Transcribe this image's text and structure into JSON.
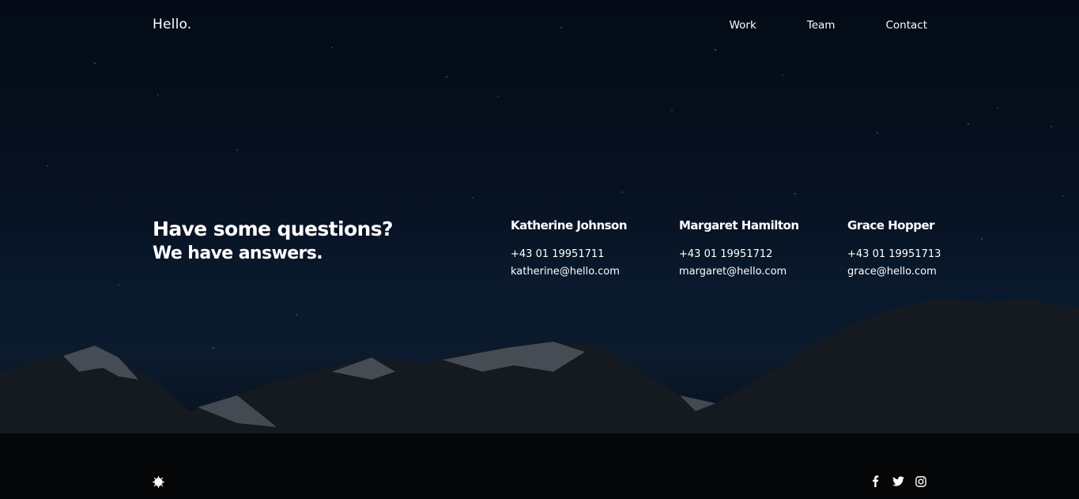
{
  "header": {
    "logo": "Hello.",
    "nav": [
      "Work",
      "Team",
      "Contact"
    ]
  },
  "hero": {
    "title": "Have some questions?",
    "subtitle": "We have answers."
  },
  "contacts": [
    {
      "name": "Katherine Johnson",
      "phone": "+43 01 19951711",
      "email": "katherine@hello.com"
    },
    {
      "name": "Margaret Hamilton",
      "phone": "+43 01 19951712",
      "email": "margaret@hello.com"
    },
    {
      "name": "Grace Hopper",
      "phone": "+43 01 19951713",
      "email": "grace@hello.com"
    }
  ],
  "footer": {
    "logo_icon": "sun-badge-icon",
    "social_icons": [
      "facebook-icon",
      "twitter-icon",
      "instagram-icon"
    ]
  }
}
